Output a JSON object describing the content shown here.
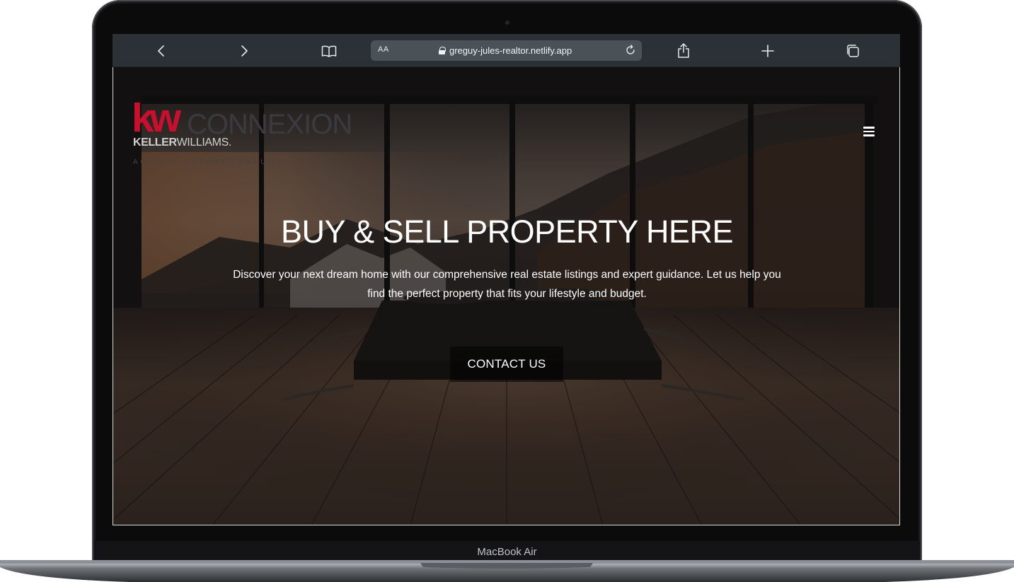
{
  "browser": {
    "url": "greguy-jules-realtor.netlify.app",
    "text_size_label": "AA",
    "icons": [
      "back-icon",
      "forward-icon",
      "bookmarks-icon",
      "lock-icon",
      "reload-icon",
      "share-icon",
      "new-tab-icon",
      "tabs-icon"
    ]
  },
  "site": {
    "logo": {
      "mark": "kw",
      "name": "CONNEXION",
      "brand_bold": "KELLER",
      "brand_light": "WILLIAMS.",
      "tagline": "AGENTS  ENTREPRENEURS"
    },
    "hero": {
      "title": "BUY & SELL PROPERTY HERE",
      "subtitle": "Discover your next dream home with our comprehensive real estate listings and expert guidance. Let us help you find the perfect property that fits your lifestyle and budget.",
      "cta_label": "CONTACT US"
    },
    "colors": {
      "brand_red": "#c8102e",
      "chrome": "#2b3137"
    }
  },
  "device": {
    "label": "MacBook Air"
  }
}
